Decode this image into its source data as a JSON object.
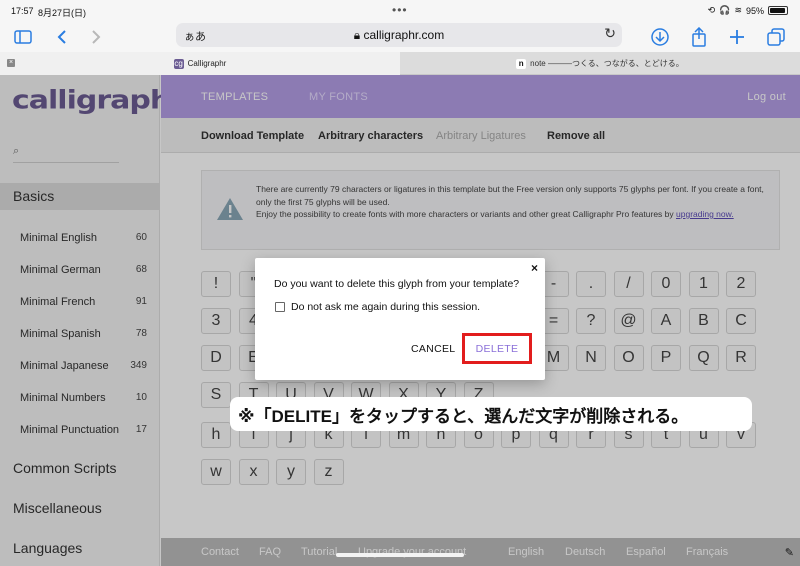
{
  "status_bar": {
    "time": "17:57",
    "date": "8月27日(日)",
    "battery": "95%",
    "battery_level": 0.95
  },
  "browser": {
    "text_size": "ぁあ",
    "url": "calligraphr.com",
    "tabs": [
      {
        "title": "Calligraphr",
        "active": true
      },
      {
        "title": "note ———つくる、つながる、とどける。",
        "active": false
      }
    ],
    "tab_close": "×",
    "tab_favicon_1": "cg",
    "tab_favicon_2": "n"
  },
  "app": {
    "logo": "calligraphr",
    "top_nav": {
      "templates": "TEMPLATES",
      "my_fonts": "MY FONTS",
      "logout": "Log out"
    },
    "sub_nav": {
      "download": "Download Template",
      "arbitrary_chars": "Arbitrary characters",
      "arbitrary_ligatures": "Arbitrary Ligatures",
      "remove_all": "Remove all"
    },
    "info": {
      "line1": "There are currently 79 characters or ligatures in this template but the Free version only supports 75 glyphs per font. If you create a font, only the first 75 glyphs will be used.",
      "line2": "Enjoy the possibility to create fonts with more characters or variants and other great Calligraphr Pro features by ",
      "link": "upgrading now."
    },
    "sidebar": {
      "basics": "Basics",
      "items": [
        {
          "label": "Minimal English",
          "count": "60"
        },
        {
          "label": "Minimal German",
          "count": "68"
        },
        {
          "label": "Minimal French",
          "count": "91"
        },
        {
          "label": "Minimal Spanish",
          "count": "78"
        },
        {
          "label": "Minimal Japanese",
          "count": "349"
        },
        {
          "label": "Minimal Numbers",
          "count": "10"
        },
        {
          "label": "Minimal Punctuation",
          "count": "17"
        }
      ],
      "common_scripts": "Common Scripts",
      "miscellaneous": "Miscellaneous",
      "languages": "Languages"
    },
    "glyphs": {
      "row1": [
        "!",
        "\"",
        "-",
        ".",
        "/",
        "0",
        "1",
        "2"
      ],
      "row2": [
        "3",
        "4",
        "=",
        "?",
        "@",
        "A",
        "B",
        "C"
      ],
      "row3": [
        "D",
        "E",
        "M",
        "N",
        "O",
        "P",
        "Q",
        "R"
      ],
      "row4": [
        "S",
        "T",
        "U",
        "V",
        "W",
        "X",
        "Y",
        "Z"
      ],
      "row5": [
        "h",
        "i",
        "j",
        "k",
        "l",
        "m",
        "n",
        "o",
        "p",
        "q",
        "r",
        "s",
        "t",
        "u",
        "v"
      ],
      "row6": [
        "w",
        "x",
        "y",
        "z"
      ]
    },
    "footer": {
      "contact": "Contact",
      "faq": "FAQ",
      "tutorial": "Tutorial",
      "upgrade": "Upgrade your account",
      "english": "English",
      "deutsch": "Deutsch",
      "espanol": "Español",
      "francais": "Français"
    }
  },
  "dialog": {
    "close": "×",
    "question": "Do you want to delete this glyph from your template?",
    "checkbox_label": "Do not ask me again during this session.",
    "cancel": "CANCEL",
    "delete": "DELETE"
  },
  "caption": "※「DELITE」をタップすると、選んだ文字が削除される。",
  "colors": {
    "accent": "#b49ee6",
    "highlight": "#e21d1d",
    "delete_text": "#8a6fd8"
  }
}
